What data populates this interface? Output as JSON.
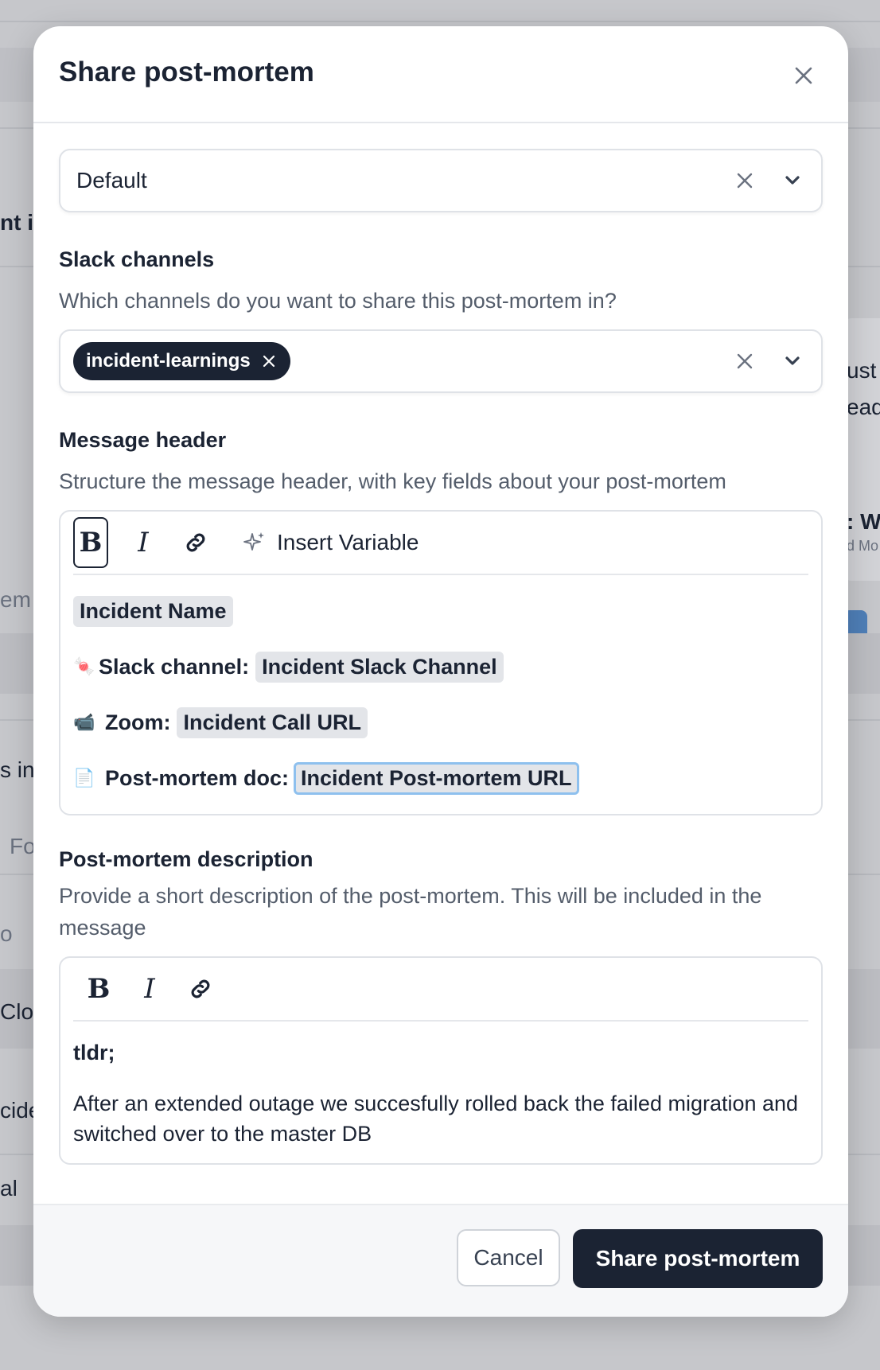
{
  "background": {
    "fragments": [
      "nt is",
      "ust",
      "ead",
      ": We",
      "d Mo",
      "em",
      "s in",
      "Fo",
      "o",
      "Clo",
      "cide",
      "al"
    ]
  },
  "modal": {
    "title": "Share post-mortem",
    "template_select": {
      "value": "Default"
    },
    "slack_channels": {
      "label": "Slack channels",
      "help": "Which channels do you want to share this post-mortem in?",
      "selected": [
        "incident-learnings"
      ]
    },
    "message_header": {
      "label": "Message header",
      "help": "Structure the message header, with key fields about your post-mortem",
      "toolbar": {
        "bold": "B",
        "italic": "I",
        "insert_variable": "Insert Variable"
      },
      "lines": {
        "name_var": "Incident Name",
        "slack_label": "Slack channel:",
        "slack_var": "Incident Slack Channel",
        "zoom_label": "Zoom:",
        "zoom_var": "Incident Call URL",
        "doc_label": "Post-mortem doc:",
        "doc_var": "Incident Post-mortem URL"
      }
    },
    "description": {
      "label": "Post-mortem description",
      "help": "Provide a short description of the post-mortem. This will be included in the message",
      "toolbar": {
        "bold": "B",
        "italic": "I"
      },
      "heading": "tldr;",
      "body": "After an extended outage we succesfully rolled back the failed migration and switched over to the master DB"
    },
    "footer": {
      "cancel": "Cancel",
      "submit": "Share post-mortem"
    }
  }
}
